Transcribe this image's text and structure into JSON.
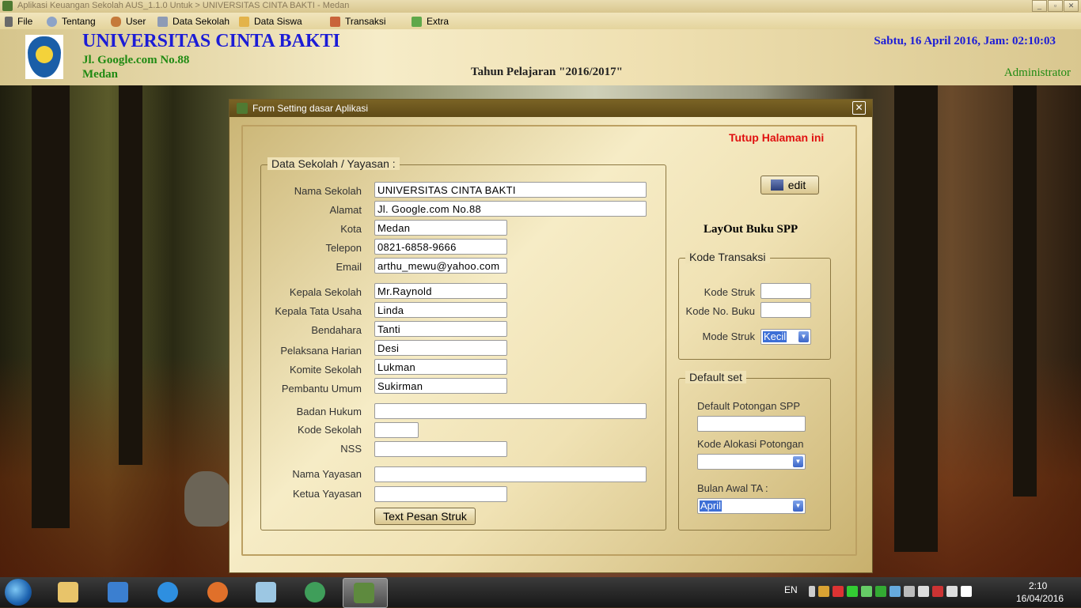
{
  "window": {
    "title": "Aplikasi Keuangan Sekolah AUS_1.1.0 Untuk > UNIVERSITAS CINTA BAKTI - Medan",
    "controls": [
      "_",
      "▫",
      "✕"
    ]
  },
  "menu": [
    {
      "label": "File",
      "icon": "file-icon"
    },
    {
      "label": "Tentang",
      "icon": "gear-icon"
    },
    {
      "label": "User",
      "icon": "user-icon"
    },
    {
      "label": "Data Sekolah",
      "icon": "school-icon"
    },
    {
      "label": "Data Siswa",
      "icon": "students-icon"
    },
    {
      "label": "Transaksi",
      "icon": "transaction-icon"
    },
    {
      "label": "Extra",
      "icon": "extra-icon"
    }
  ],
  "header": {
    "university": "UNIVERSITAS CINTA BAKTI",
    "address": "Jl. Google.com No.88",
    "city": "Medan",
    "tahun": "Tahun Pelajaran \"2016/2017\"",
    "datetime": "Sabtu, 16 April 2016, Jam: 02:10:03",
    "user": "Administrator"
  },
  "dialog": {
    "title": "Form Setting dasar Aplikasi",
    "close_link": "Tutup Halaman ini",
    "edit_button": "edit",
    "layout_title": "LayOut Buku SPP",
    "school_group": {
      "label": "Data Sekolah / Yayasan :",
      "fields": {
        "nama_sekolah": {
          "label": "Nama Sekolah",
          "value": "UNIVERSITAS CINTA BAKTI"
        },
        "alamat": {
          "label": "Alamat",
          "value": "Jl. Google.com No.88"
        },
        "kota": {
          "label": "Kota",
          "value": "Medan"
        },
        "telepon": {
          "label": "Telepon",
          "value": "0821-6858-9666"
        },
        "email": {
          "label": "Email",
          "value": "arthu_mewu@yahoo.com"
        },
        "kepala_sekolah": {
          "label": "Kepala Sekolah",
          "value": "Mr.Raynold"
        },
        "kepala_tu": {
          "label": "Kepala Tata Usaha",
          "value": "Linda"
        },
        "bendahara": {
          "label": "Bendahara",
          "value": "Tanti"
        },
        "pelaksana": {
          "label": "Pelaksana Harian",
          "value": "Desi"
        },
        "komite": {
          "label": "Komite Sekolah",
          "value": "Lukman"
        },
        "pembantu": {
          "label": "Pembantu Umum",
          "value": "Sukirman"
        },
        "badan_hukum": {
          "label": "Badan Hukum",
          "value": ""
        },
        "kode_sekolah": {
          "label": "Kode Sekolah",
          "value": ""
        },
        "nss": {
          "label": "NSS",
          "value": ""
        },
        "nama_yayasan": {
          "label": "Nama Yayasan",
          "value": ""
        },
        "ketua_yayasan": {
          "label": "Ketua Yayasan",
          "value": ""
        }
      },
      "pesan_button": "Text Pesan Struk"
    },
    "kode_group": {
      "label": "Kode Transaksi",
      "kode_struk_label": "Kode Struk",
      "kode_struk_value": "",
      "kode_buku_label": "Kode No. Buku",
      "kode_buku_value": "",
      "mode_label": "Mode Struk",
      "mode_value": "Kecil"
    },
    "default_group": {
      "label": "Default set",
      "potongan_label": "Default Potongan SPP",
      "potongan_value": "",
      "alokasi_label": "Kode Alokasi Potongan",
      "alokasi_value": "",
      "bulan_label": "Bulan Awal TA :",
      "bulan_value": "April"
    }
  },
  "taskbar": {
    "lang": "EN",
    "time": "2:10",
    "date": "16/04/2016"
  },
  "colors": {
    "brand_blue": "#1c1cd6",
    "brand_green": "#1f8a12",
    "close_red": "#e01010"
  }
}
